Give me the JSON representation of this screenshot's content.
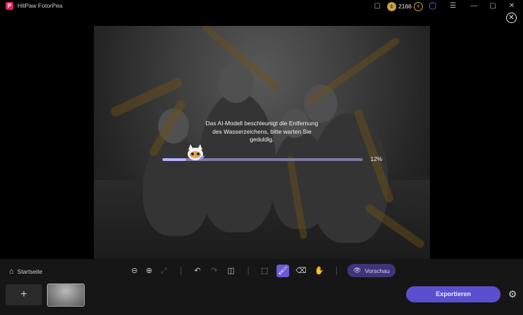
{
  "app": {
    "title": "HitPaw FotorPea",
    "logo_letter": "P"
  },
  "titlebar": {
    "coins": "2166",
    "coin_add": "+",
    "icons": [
      "chat-icon",
      "coin-icon",
      "user-icon",
      "menu-icon",
      "minimize-icon",
      "maximize-icon",
      "window-close-icon"
    ],
    "glyphs": {
      "chat": "▢",
      "user": "◯",
      "menu": "☰",
      "minimize": "—",
      "maximize": "▢",
      "close": "✕"
    }
  },
  "canvas": {
    "close_glyph": "✕"
  },
  "progress": {
    "message": "Das AI-Modell beschleunigt die Entfernung des Wasserzeichens, bitte warten Sie geduldig.",
    "percent_label": "12%",
    "value": 0.12
  },
  "toolbar": {
    "home_label": "Startseite",
    "home_glyph": "⌂",
    "zoom_out": "⊖",
    "zoom_in": "⊕",
    "fit": "⤢",
    "undo": "↶",
    "redo": "↷",
    "compare": "◫",
    "select": "⬚",
    "brush": "🖌",
    "eraser": "⌫",
    "hand": "✋",
    "preview_label": "Vorschau",
    "preview_glyph": "👁"
  },
  "footer": {
    "add_glyph": "+",
    "export_label": "Exportieren",
    "settings_glyph": "⚙"
  },
  "colors": {
    "accent": "#5a4fcf",
    "coin": "#c8a24a",
    "watermark": "#be8c28"
  }
}
